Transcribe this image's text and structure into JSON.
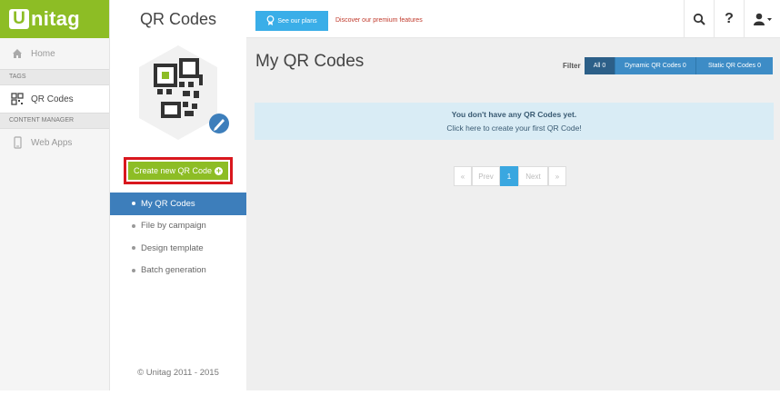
{
  "brand": {
    "logo_initial": "U",
    "logo_rest": "nitag",
    "color": "#8dbd25"
  },
  "sidebar": {
    "home": "Home",
    "section_tags": "TAGS",
    "qr_codes": "QR Codes",
    "section_content": "CONTENT MANAGER",
    "web_apps": "Web Apps"
  },
  "panel": {
    "title": "QR Codes",
    "create_button": "Create new QR Code",
    "subnav": [
      "My QR Codes",
      "File by campaign",
      "Design template",
      "Batch generation"
    ],
    "copyright": "© Unitag 2011 - 2015"
  },
  "topbar": {
    "plans_button": "See our plans",
    "premium_link": "Discover our premium features",
    "icons": [
      "search-icon",
      "help-icon",
      "user-icon"
    ]
  },
  "main": {
    "title": "My QR Codes",
    "filter_label": "Filter",
    "filters": [
      "All 0",
      "Dynamic QR Codes 0",
      "Static QR Codes 0"
    ],
    "alert_line1": "You don't have any QR Codes yet.",
    "alert_line2": "Click here to create your first QR Code!",
    "pager": {
      "first": "«",
      "prev": "Prev",
      "current": "1",
      "next": "Next",
      "last": "»"
    }
  },
  "colors": {
    "accent_blue": "#3d8cc6",
    "alert_bg": "#d9ecf5",
    "highlight_red": "#d9171e"
  }
}
